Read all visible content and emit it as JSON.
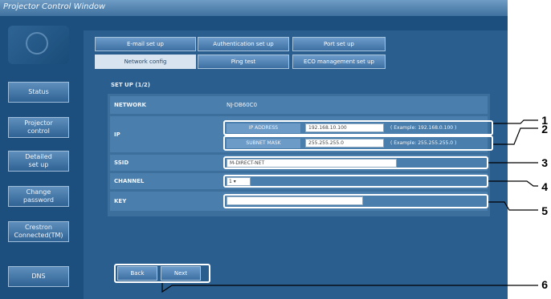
{
  "window": {
    "title": "Projector Control Window"
  },
  "sidebar": {
    "items": [
      {
        "label": "Status"
      },
      {
        "label": "Projector\ncontrol"
      },
      {
        "label": "Detailed\nset up"
      },
      {
        "label": "Change\npassword"
      },
      {
        "label": "Crestron\nConnected(TM)"
      },
      {
        "label": "DNS"
      }
    ]
  },
  "tabs": [
    {
      "label": "E-mail set up"
    },
    {
      "label": "Authentication set up"
    },
    {
      "label": "Port set up"
    },
    {
      "label": "Network config"
    },
    {
      "label": "Ping test"
    },
    {
      "label": "ECO management set up"
    }
  ],
  "form": {
    "section_label": "SET UP (1/2)",
    "network": {
      "label": "NETWORK",
      "value": "NJ-DB60C0"
    },
    "ip": {
      "label": "IP",
      "ip_address": {
        "label": "IP ADDRESS",
        "value": "192.168.10.100",
        "example": "( Example: 192.168.0.100 )"
      },
      "subnet_mask": {
        "label": "SUBNET MASK",
        "value": "255.255.255.0",
        "example": "( Example: 255.255.255.0 )"
      }
    },
    "ssid": {
      "label": "SSID",
      "value": "M-DIRECT-NET"
    },
    "channel": {
      "label": "CHANNEL",
      "value": "1"
    },
    "key": {
      "label": "KEY",
      "value": ""
    }
  },
  "buttons": {
    "back": "Back",
    "next": "Next"
  },
  "callouts": [
    "1",
    "2",
    "3",
    "4",
    "5",
    "6"
  ]
}
